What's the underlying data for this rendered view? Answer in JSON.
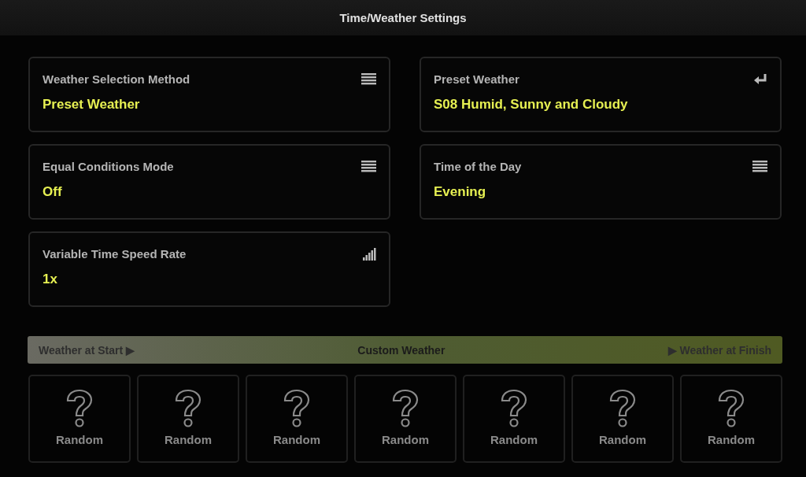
{
  "header": {
    "title": "Time/Weather Settings"
  },
  "settings": [
    {
      "label": "Weather Selection Method",
      "value": "Preset Weather",
      "kind": "list"
    },
    {
      "label": "Preset Weather",
      "value": "S08 Humid, Sunny and Cloudy",
      "kind": "enter"
    },
    {
      "label": "Equal Conditions Mode",
      "value": "Off",
      "kind": "list"
    },
    {
      "label": "Time of the Day",
      "value": "Evening",
      "kind": "list"
    },
    {
      "label": "Variable Time Speed Rate",
      "value": "1x",
      "kind": "bars"
    }
  ],
  "custom_weather": {
    "start_label": "Weather at Start",
    "title": "Custom Weather",
    "finish_label": "Weather at Finish",
    "arrow": "▶",
    "slots": [
      {
        "label": "Random"
      },
      {
        "label": "Random"
      },
      {
        "label": "Random"
      },
      {
        "label": "Random"
      },
      {
        "label": "Random"
      },
      {
        "label": "Random"
      },
      {
        "label": "Random"
      }
    ]
  }
}
